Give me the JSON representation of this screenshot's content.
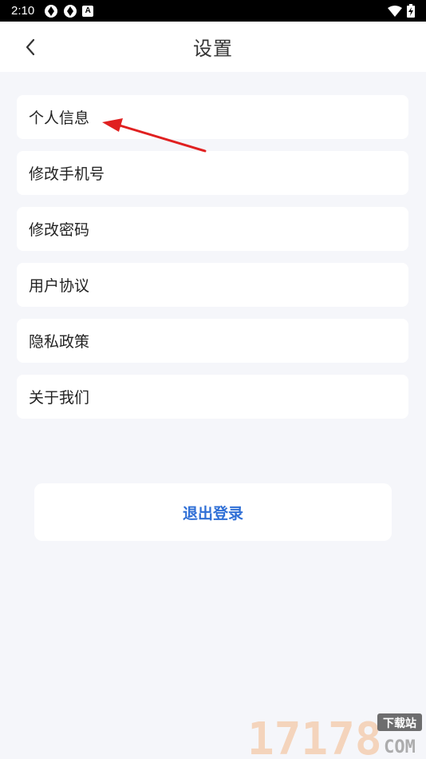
{
  "status_bar": {
    "time": "2:10",
    "notification_a": "A"
  },
  "header": {
    "title": "设置"
  },
  "menu": {
    "items": [
      {
        "label": "个人信息"
      },
      {
        "label": "修改手机号"
      },
      {
        "label": "修改密码"
      },
      {
        "label": "用户协议"
      },
      {
        "label": "隐私政策"
      },
      {
        "label": "关于我们"
      }
    ]
  },
  "logout": {
    "label": "退出登录"
  },
  "watermark": {
    "number": "17178",
    "tag": "下载站",
    "domain": "COM"
  },
  "colors": {
    "accent": "#2f6fd6",
    "annotation_arrow": "#e02020",
    "background": "#f5f6fa"
  }
}
